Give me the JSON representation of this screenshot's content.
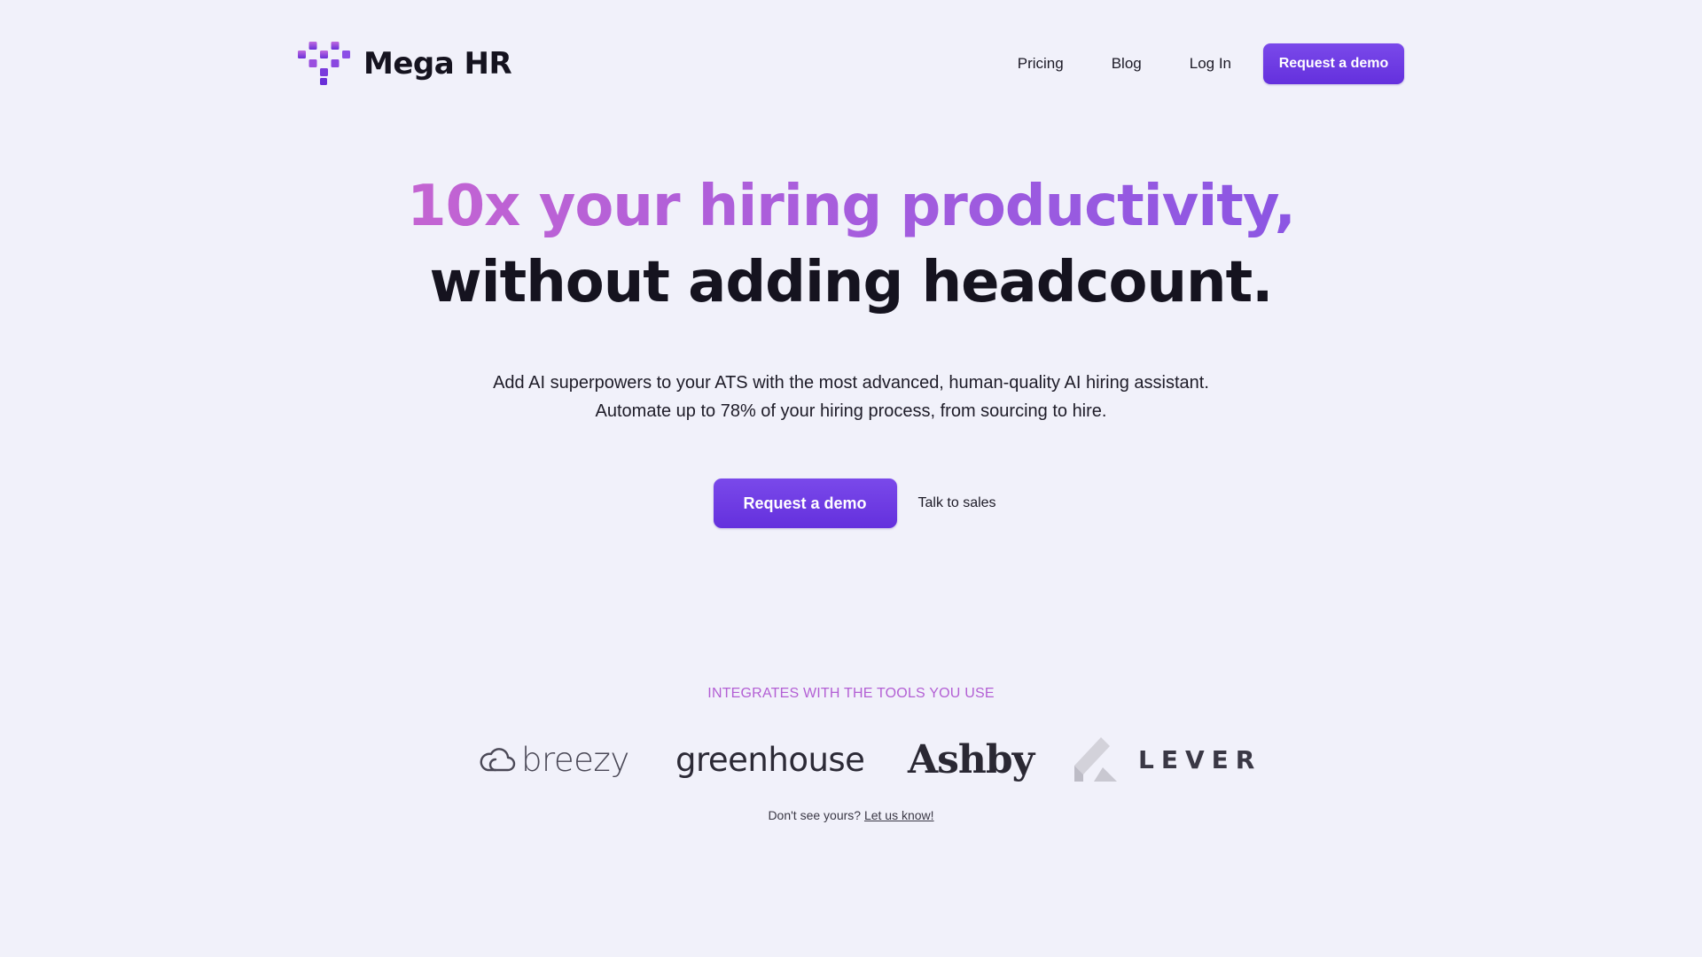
{
  "brand": {
    "name": "Mega HR",
    "logo_icon": "pixel-heart-logo",
    "accent_color": "#6b36e2",
    "gradient_colors": [
      "#c464d2",
      "#8b56e3"
    ]
  },
  "nav": {
    "links": [
      {
        "label": "Pricing"
      },
      {
        "label": "Blog"
      },
      {
        "label": "Log In"
      }
    ],
    "cta_label": "Request a demo"
  },
  "hero": {
    "headline_line1": "10x your hiring productivity,",
    "headline_line2": "without adding headcount.",
    "subtitle_line1": "Add AI superpowers to your ATS with the most advanced, human-quality AI hiring assistant.",
    "subtitle_line2": "Automate up to 78% of your hiring process, from sourcing to hire.",
    "primary_cta": "Request a demo",
    "secondary_cta": "Talk to sales"
  },
  "integrations": {
    "heading": "INTEGRATES WITH THE TOOLS YOU USE",
    "logos": [
      {
        "name": "breezy",
        "icon": "cloud-icon"
      },
      {
        "name": "greenhouse",
        "icon": ""
      },
      {
        "name": "Ashby",
        "icon": ""
      },
      {
        "name": "LEVER",
        "icon": "lever-icon"
      }
    ],
    "footnote_text": "Don't see yours?",
    "footnote_link": "Let us know!"
  }
}
